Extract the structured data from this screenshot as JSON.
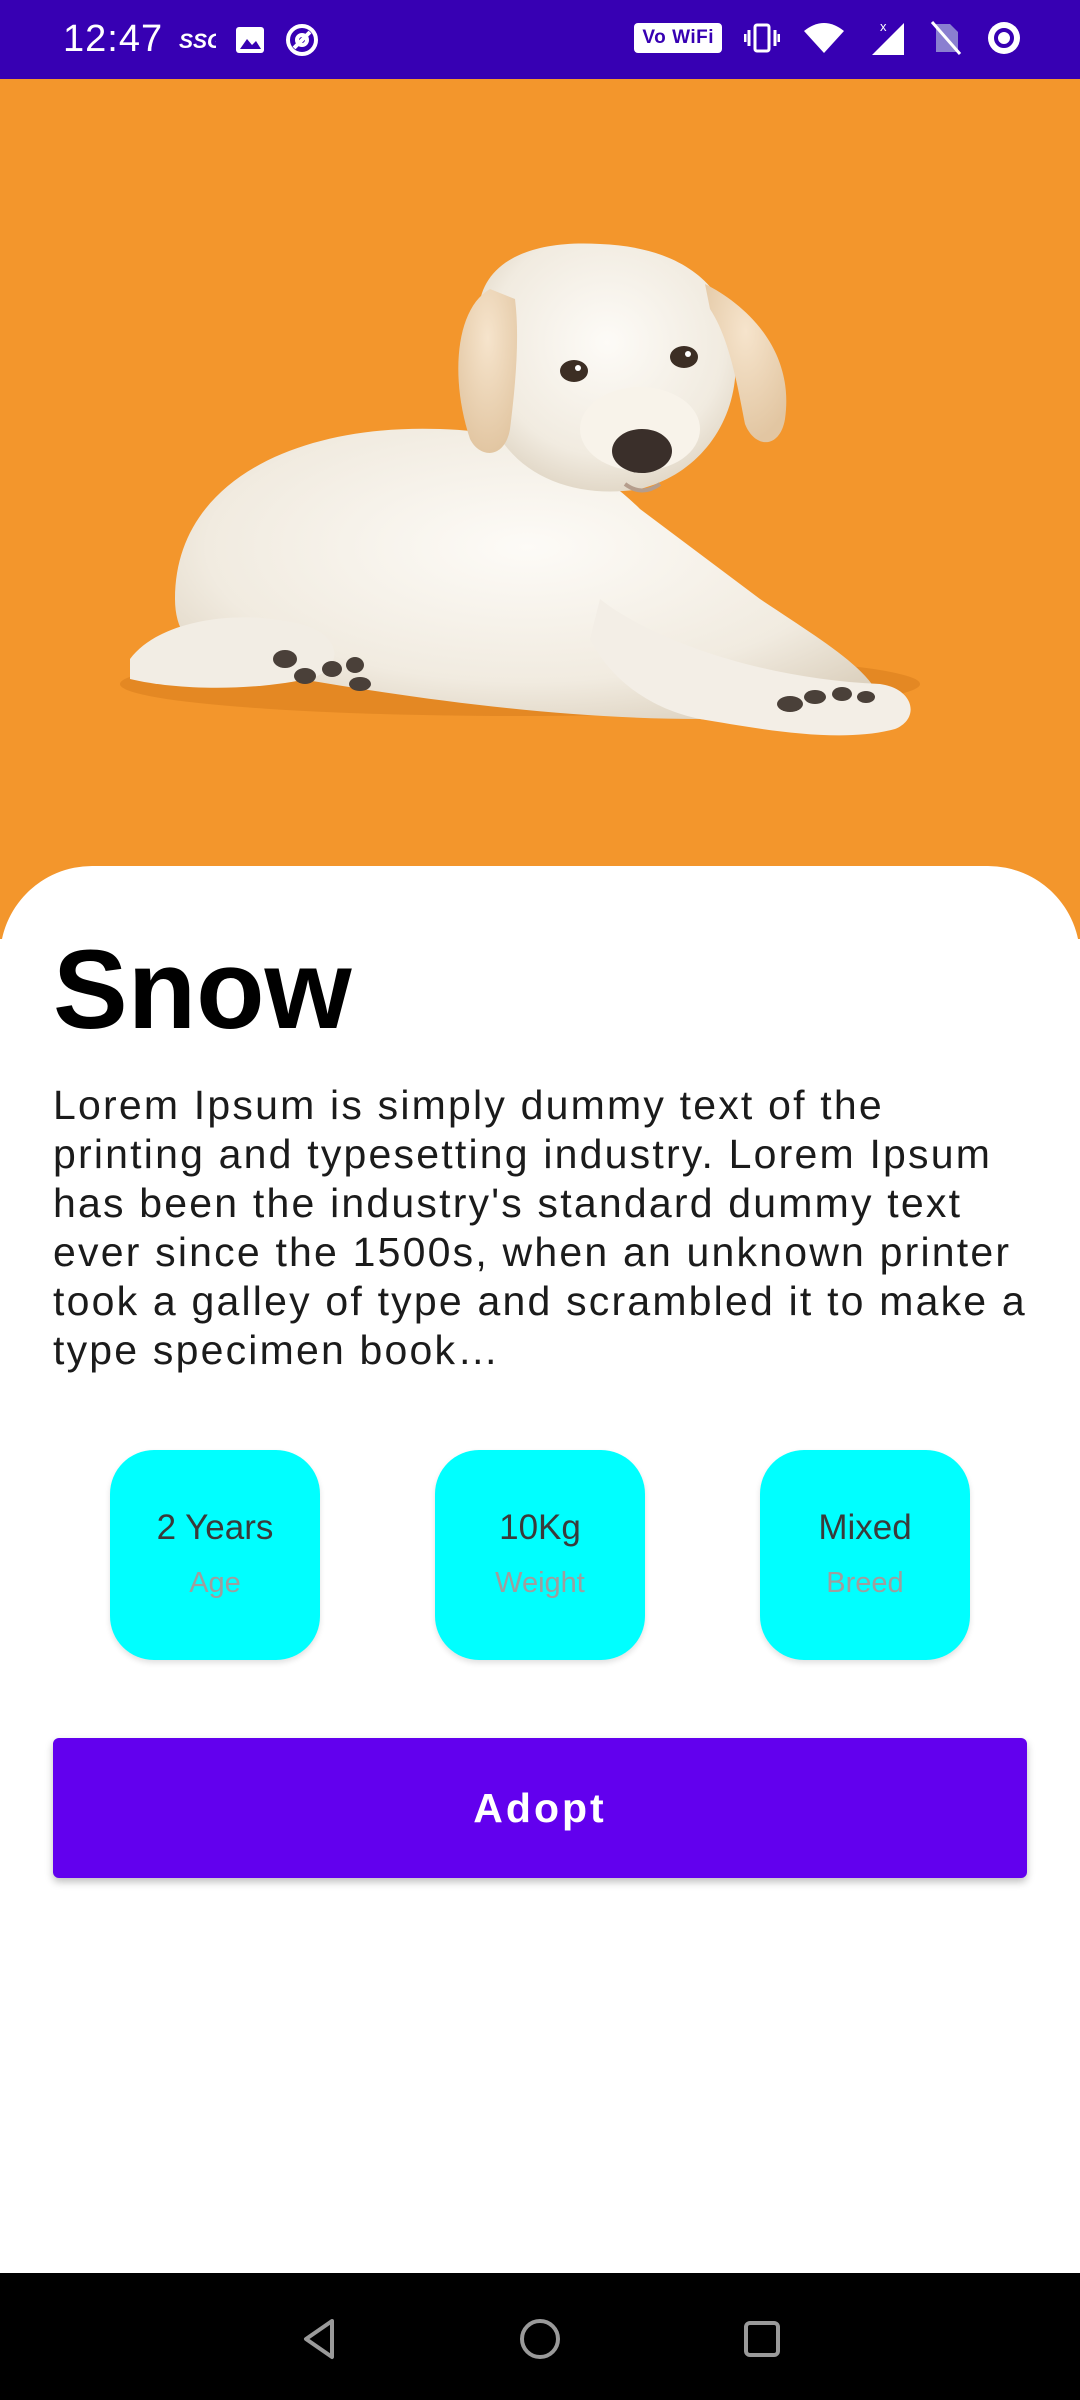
{
  "status_bar": {
    "time": "12:47",
    "left_icons": [
      "ssg-icon",
      "image-icon",
      "at-sign-icon"
    ],
    "vowifi_label": "Vo WiFi",
    "right_icons": [
      "vibrate-icon",
      "wifi-icon",
      "signal-icon",
      "no-sim-icon",
      "ring-icon"
    ]
  },
  "hero": {
    "background_color": "#f3962c",
    "image_subject": "puppy-image"
  },
  "pet": {
    "name": "Snow",
    "description": "Lorem Ipsum is simply dummy text of the printing and typesetting industry. Lorem Ipsum has been the industry's standard dummy text ever since the 1500s, when an unknown printer took a galley of type and scrambled it to make a type specimen book…"
  },
  "stats": [
    {
      "value": "2 Years",
      "label": "Age"
    },
    {
      "value": "10Kg",
      "label": "Weight"
    },
    {
      "value": "Mixed",
      "label": "Breed"
    }
  ],
  "adopt_button": {
    "label": "Adopt",
    "color": "#6200ee"
  },
  "colors": {
    "status_bar": "#3700b3",
    "stat_card": "#00ffff"
  },
  "nav_bar": {
    "buttons": [
      "back-icon",
      "home-icon",
      "recents-icon"
    ]
  }
}
